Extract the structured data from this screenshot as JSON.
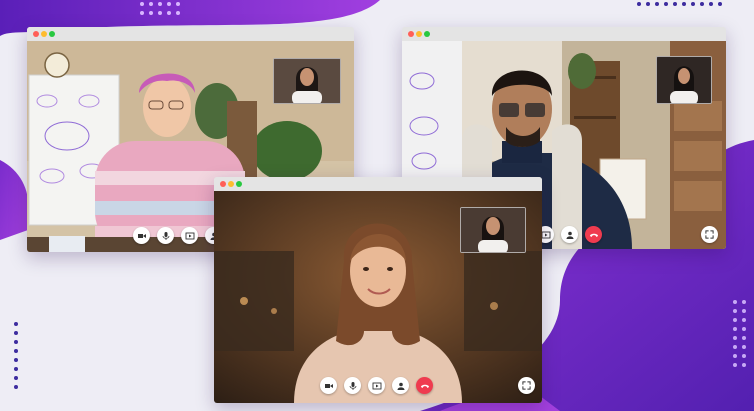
{
  "colors": {
    "background": "#eeedf5",
    "purple_dark": "#5b1fb5",
    "purple_light": "#9b3fd6",
    "hangup_red": "#ef3b4f",
    "dot_color": "#4a2fa8"
  },
  "windows": [
    {
      "id": "woman-pink-sweater",
      "controls": [
        "video-camera-icon",
        "microphone-icon",
        "screen-share-icon",
        "add-user-icon",
        "hang-up-icon"
      ]
    },
    {
      "id": "man-glasses",
      "controls": [
        "video-camera-icon",
        "microphone-icon",
        "screen-share-icon",
        "add-user-icon",
        "hang-up-icon"
      ],
      "fullscreen": "fullscreen-icon"
    },
    {
      "id": "woman-center",
      "controls": [
        "video-camera-icon",
        "microphone-icon",
        "screen-share-icon",
        "add-user-icon",
        "hang-up-icon"
      ],
      "fullscreen": "fullscreen-icon"
    }
  ]
}
